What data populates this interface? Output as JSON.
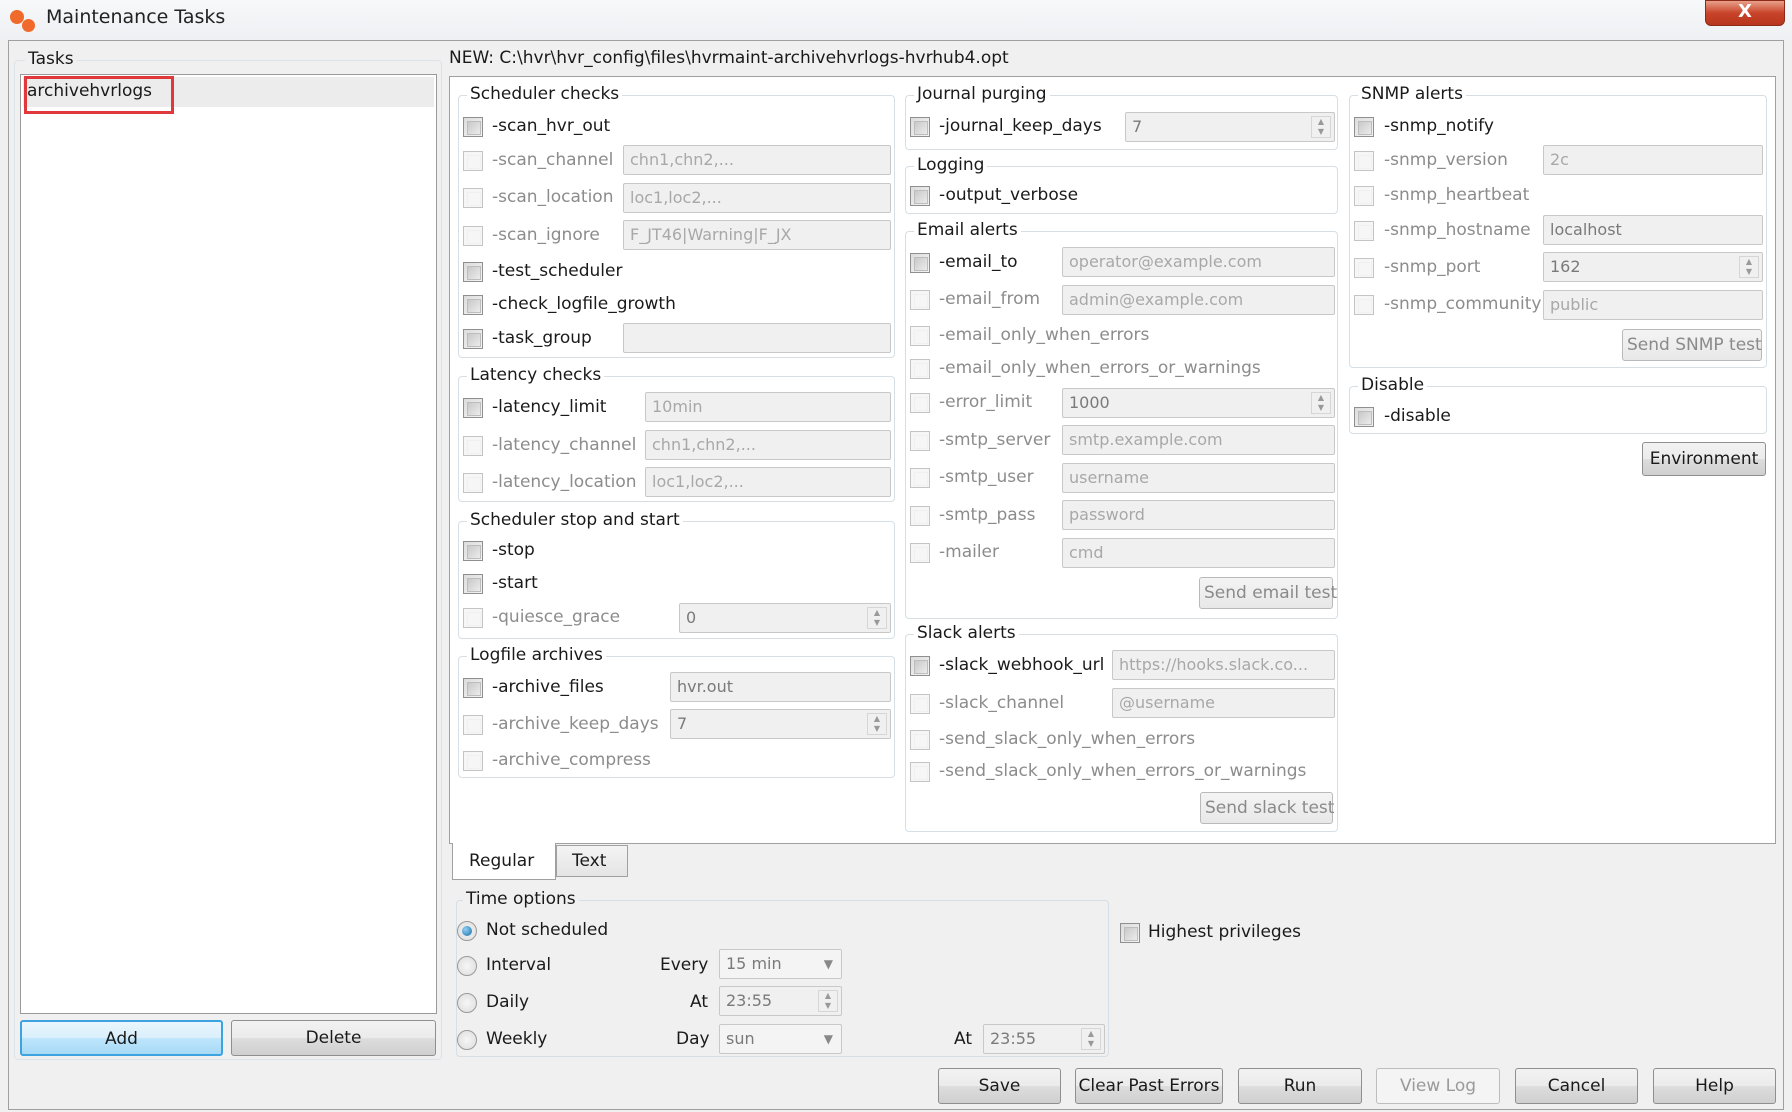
{
  "window": {
    "title": "Maintenance Tasks",
    "close_label": "X"
  },
  "tasks_panel": {
    "title": "Tasks",
    "items": [
      {
        "label": "archivehvrlogs",
        "selected": true,
        "highlighted": true
      }
    ],
    "add_label": "Add",
    "delete_label": "Delete"
  },
  "path_label": "NEW: C:\\hvr\\hvr_config\\files\\hvrmaint-archivehvrlogs-hvrhub4.opt",
  "scheduler_checks": {
    "title": "Scheduler checks",
    "scan_hvr_out": {
      "label": "-scan_hvr_out",
      "checked": false
    },
    "scan_channel": {
      "label": "-scan_channel",
      "placeholder": "chn1,chn2,..."
    },
    "scan_location": {
      "label": "-scan_location",
      "placeholder": "loc1,loc2,..."
    },
    "scan_ignore": {
      "label": "-scan_ignore",
      "placeholder": "F_JT46|Warning|F_JX"
    },
    "test_scheduler": {
      "label": "-test_scheduler",
      "checked": false
    },
    "check_logfile_growth": {
      "label": "-check_logfile_growth",
      "checked": false
    },
    "task_group": {
      "label": "-task_group",
      "value": ""
    }
  },
  "latency_checks": {
    "title": "Latency checks",
    "latency_limit": {
      "label": "-latency_limit",
      "placeholder": "10min"
    },
    "latency_channel": {
      "label": "-latency_channel",
      "placeholder": "chn1,chn2,..."
    },
    "latency_location": {
      "label": "-latency_location",
      "placeholder": "loc1,loc2,..."
    }
  },
  "scheduler_stop_start": {
    "title": "Scheduler stop and start",
    "stop": {
      "label": "-stop"
    },
    "start": {
      "label": "-start"
    },
    "quiesce_grace": {
      "label": "-quiesce_grace",
      "value": "0"
    }
  },
  "logfile_archives": {
    "title": "Logfile archives",
    "archive_files": {
      "label": "-archive_files",
      "value": "hvr.out"
    },
    "archive_keep_days": {
      "label": "-archive_keep_days",
      "value": "7"
    },
    "archive_compress": {
      "label": "-archive_compress"
    }
  },
  "journal_purging": {
    "title": "Journal purging",
    "journal_keep_days": {
      "label": "-journal_keep_days",
      "value": "7"
    }
  },
  "logging": {
    "title": "Logging",
    "output_verbose": {
      "label": "-output_verbose"
    }
  },
  "email_alerts": {
    "title": "Email alerts",
    "email_to": {
      "label": "-email_to",
      "placeholder": "operator@example.com"
    },
    "email_from": {
      "label": "-email_from",
      "placeholder": "admin@example.com"
    },
    "email_only_when_errors": {
      "label": "-email_only_when_errors"
    },
    "email_only_when_errors_or_warnings": {
      "label": "-email_only_when_errors_or_warnings"
    },
    "error_limit": {
      "label": "-error_limit",
      "value": "1000"
    },
    "smtp_server": {
      "label": "-smtp_server",
      "placeholder": "smtp.example.com"
    },
    "smtp_user": {
      "label": "-smtp_user",
      "placeholder": "username"
    },
    "smtp_pass": {
      "label": "-smtp_pass",
      "placeholder": "password"
    },
    "mailer": {
      "label": "-mailer",
      "placeholder": "cmd"
    },
    "send_test_label": "Send email test"
  },
  "slack_alerts": {
    "title": "Slack alerts",
    "slack_webhook_url": {
      "label": "-slack_webhook_url",
      "placeholder": "https://hooks.slack.co..."
    },
    "slack_channel": {
      "label": "-slack_channel",
      "placeholder": "@username"
    },
    "send_slack_only_when_errors": {
      "label": "-send_slack_only_when_errors"
    },
    "send_slack_only_when_errors_or_warnings": {
      "label": "-send_slack_only_when_errors_or_warnings"
    },
    "send_test_label": "Send slack test"
  },
  "snmp_alerts": {
    "title": "SNMP alerts",
    "snmp_notify": {
      "label": "-snmp_notify"
    },
    "snmp_version": {
      "label": "-snmp_version",
      "placeholder": "2c"
    },
    "snmp_heartbeat": {
      "label": "-snmp_heartbeat"
    },
    "snmp_hostname": {
      "label": "-snmp_hostname",
      "value": "localhost"
    },
    "snmp_port": {
      "label": "-snmp_port",
      "value": "162"
    },
    "snmp_community": {
      "label": "-snmp_community",
      "placeholder": "public"
    },
    "send_test_label": "Send SNMP test"
  },
  "disable": {
    "title": "Disable",
    "disable": {
      "label": "-disable"
    }
  },
  "environment_label": "Environment",
  "tabs": [
    {
      "label": "Regular",
      "active": true
    },
    {
      "label": "Text",
      "active": false
    }
  ],
  "time_options": {
    "title": "Time options",
    "not_scheduled": {
      "label": "Not scheduled",
      "selected": true
    },
    "interval": {
      "label": "Interval",
      "every_label": "Every",
      "every_value": "15 min"
    },
    "daily": {
      "label": "Daily",
      "at_label": "At",
      "at_value": "23:55"
    },
    "weekly": {
      "label": "Weekly",
      "day_label": "Day",
      "day_value": "sun",
      "at_label": "At",
      "at_value": "23:55"
    }
  },
  "highest_privileges": {
    "label": "Highest privileges",
    "checked": false
  },
  "footer": {
    "save": "Save",
    "clear_past_errors": "Clear Past Errors",
    "run": "Run",
    "view_log": "View Log",
    "cancel": "Cancel",
    "help": "Help"
  }
}
